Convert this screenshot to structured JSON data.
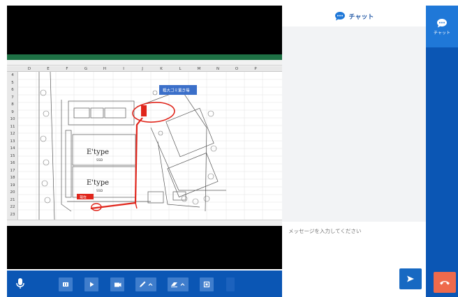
{
  "chat": {
    "title": "チャット",
    "input_placeholder": "メッセージを入力してください",
    "send_icon": "send-arrow-icon"
  },
  "rail": {
    "chat_label": "チャット",
    "hangup_icon": "phone-hangup-icon"
  },
  "toolbar": {
    "items": [
      "mic-icon",
      "media-icon",
      "play-icon",
      "camera-icon",
      "pen-icon",
      "eraser-icon",
      "share-icon",
      "dot-icon"
    ]
  },
  "shared_screen": {
    "column_headers": [
      "D",
      "E",
      "F",
      "G",
      "H",
      "I",
      "J",
      "K",
      "L",
      "M",
      "N",
      "O",
      "P"
    ],
    "row_headers": [
      "4",
      "5",
      "6",
      "7",
      "8",
      "9",
      "10",
      "11",
      "12",
      "13",
      "14",
      "15",
      "16",
      "17",
      "18",
      "19",
      "20",
      "21",
      "22",
      "23"
    ],
    "callout_text": "粗大ゴミ置き場",
    "start_tag": "現在",
    "building_1": "E'type",
    "building_1_sub": "SSD",
    "building_2": "E'type",
    "building_2_sub": "SSD"
  },
  "colors": {
    "accent_blue": "#0b56b4",
    "light_blue": "#1f78d8",
    "hangup": "#ef6a4c",
    "route_red": "#e0261c"
  }
}
